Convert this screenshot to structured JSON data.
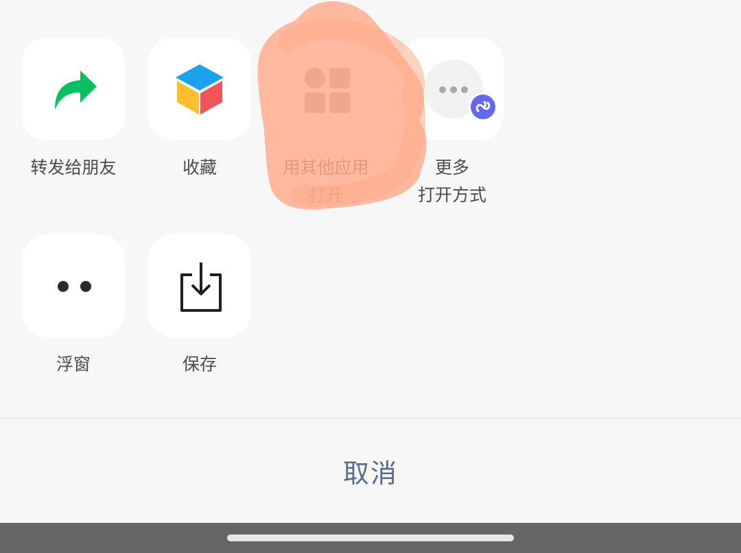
{
  "actions": [
    {
      "id": "forward",
      "label": "转发给朋友",
      "icon": "forward-arrow-icon"
    },
    {
      "id": "favorite",
      "label": "收藏",
      "icon": "favorites-cube-icon"
    },
    {
      "id": "open-other",
      "label": "用其他应用\n打开",
      "icon": "apps-grid-icon"
    },
    {
      "id": "more-open",
      "label": "更多\n打开方式",
      "icon": "more-dots-icon"
    },
    {
      "id": "float",
      "label": "浮窗",
      "icon": "float-window-icon"
    },
    {
      "id": "save",
      "label": "保存",
      "icon": "save-download-icon"
    }
  ],
  "cancel_label": "取消",
  "colors": {
    "forward_green": "#07c160",
    "cube_top": "#1aa3f0",
    "cube_left": "#fbc02d",
    "cube_right": "#f2545b",
    "mini_program_badge": "#6467f0",
    "cancel_text": "#576b95",
    "scribble": "#ffab8a"
  }
}
